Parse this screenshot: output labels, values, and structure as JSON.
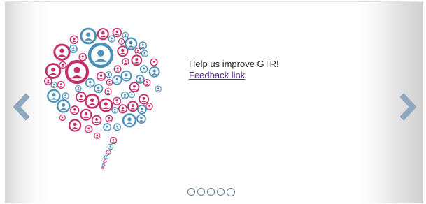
{
  "slide": {
    "message": "Help us improve GTR!",
    "link_label": "Feedback link"
  },
  "carousel": {
    "slide_count": 5,
    "active_index": 4
  },
  "colors": {
    "pink": "#c42f6a",
    "blue": "#4c90b8",
    "arrow": "#8fa7bf",
    "link": "#54268f"
  },
  "icons": {
    "prev": "chevron-left-icon",
    "next": "chevron-right-icon",
    "graphic": "speech-bubble-people-icon"
  }
}
